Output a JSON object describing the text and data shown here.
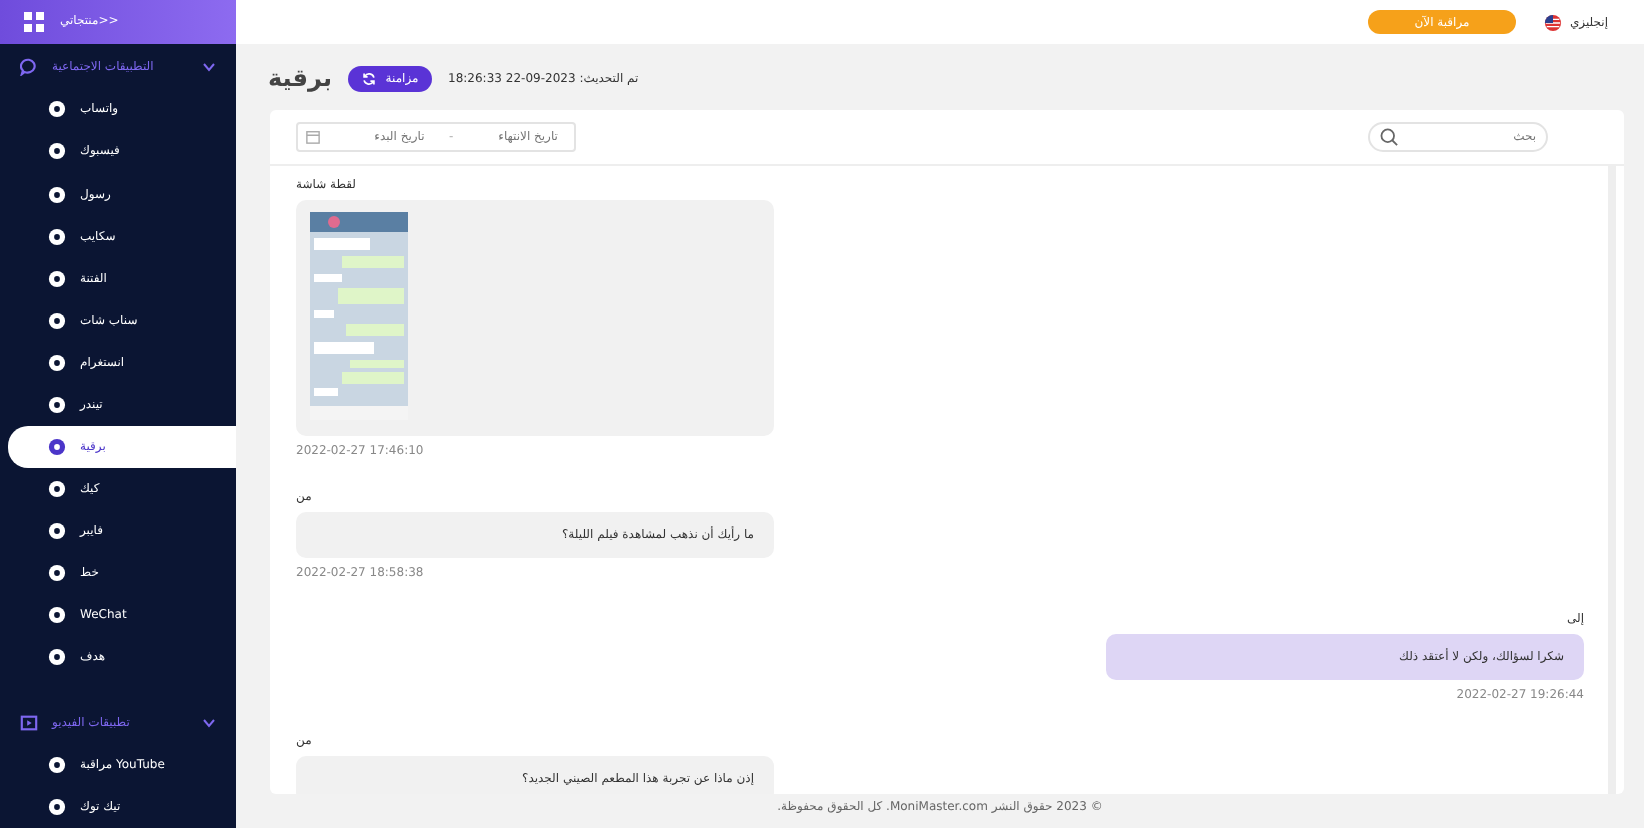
{
  "sidebar": {
    "brand": "منتجاتي>>",
    "sections": [
      {
        "title": "التطبيقات الاجتماعية",
        "expanded": true,
        "items": [
          {
            "label": "واتساب",
            "selected": false
          },
          {
            "label": "فيسبوك",
            "selected": false
          },
          {
            "label": "رسول",
            "selected": false
          },
          {
            "label": "سكايب",
            "selected": false
          },
          {
            "label": "الفتنة",
            "selected": false
          },
          {
            "label": "سناب شات",
            "selected": false
          },
          {
            "label": "انستغرام",
            "selected": false
          },
          {
            "label": "تيندر",
            "selected": false
          },
          {
            "label": "برقية",
            "selected": true
          },
          {
            "label": "كيك",
            "selected": false
          },
          {
            "label": "فايبر",
            "selected": false
          },
          {
            "label": "خط",
            "selected": false
          },
          {
            "label": "WeChat",
            "selected": false
          },
          {
            "label": "هدف",
            "selected": false
          }
        ]
      },
      {
        "title": "تطبيقات الفيديو",
        "expanded": true,
        "items": [
          {
            "label": "مراقبة YouTube",
            "selected": false
          },
          {
            "label": "تيك توك",
            "selected": false
          }
        ]
      }
    ]
  },
  "header": {
    "language": "إنجليزي",
    "monitor_button": "مراقبة الآن"
  },
  "page": {
    "title": "برقية",
    "sync_button": "مزامنة",
    "updated": "تم التحديث: 2023-09-22 18:26:33"
  },
  "filters": {
    "start_placeholder": "تاريخ البدء",
    "separator": "-",
    "end_placeholder": "تاريخ الانتهاء",
    "search_placeholder": "بحث"
  },
  "messages": [
    {
      "kind": "image",
      "outgoing": false,
      "label": "لقطة شاشة",
      "time": "2022-02-27 17:46:10"
    },
    {
      "kind": "text",
      "outgoing": false,
      "label": "من",
      "text": "ما رأيك أن نذهب لمشاهدة فيلم الليلة؟",
      "time": "2022-02-27 18:58:38"
    },
    {
      "kind": "text",
      "outgoing": true,
      "label": "إلى",
      "text": "شكرا لسؤالك، ولكن لا أعتقد ذلك",
      "time": "2022-02-27 19:26:44"
    },
    {
      "kind": "text",
      "outgoing": false,
      "label": "من",
      "text": "إذن ماذا عن تجربة هذا المطعم الصيني الجديد؟"
    }
  ],
  "footer": "© 2023 حقوق النشر MoniMaster.com. كل الحقوق محفوظة."
}
